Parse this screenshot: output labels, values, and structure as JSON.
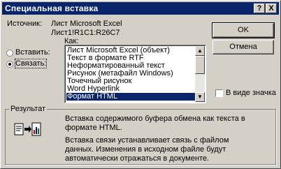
{
  "dialog": {
    "title": "Специальная вставка",
    "help_button": "?",
    "close_button": "X"
  },
  "source": {
    "label": "Источник:",
    "line1": "Лист Microsoft Excel",
    "line2": "Лист1!R1C1:R26C7"
  },
  "buttons": {
    "ok": "OK",
    "cancel": "Отмена"
  },
  "radios": {
    "paste": "Вставить:",
    "link": "Связать:",
    "selected": "link"
  },
  "list": {
    "label": "Как:",
    "items": [
      "Лист Microsoft Excel (объект)",
      "Текст в формате RTF",
      "Неформатированный текст",
      "Рисунок (метафайл Windows)",
      "Точечный рисунок",
      "Word Hyperlink",
      "Формат HTML"
    ],
    "selected_index": 6
  },
  "icon_checkbox": {
    "label": "В виде значка",
    "checked": false
  },
  "result": {
    "label": "Результат",
    "para1_line1": "Вставка содержимого буфера обмена как текста в",
    "para1_line2": "формате HTML.",
    "para2_line1": "Вставка связи устанавливает связь с файлом",
    "para2_line2": "данных. Изменения в исходном файле будут",
    "para2_line3": "автоматически отражаться в документе."
  }
}
